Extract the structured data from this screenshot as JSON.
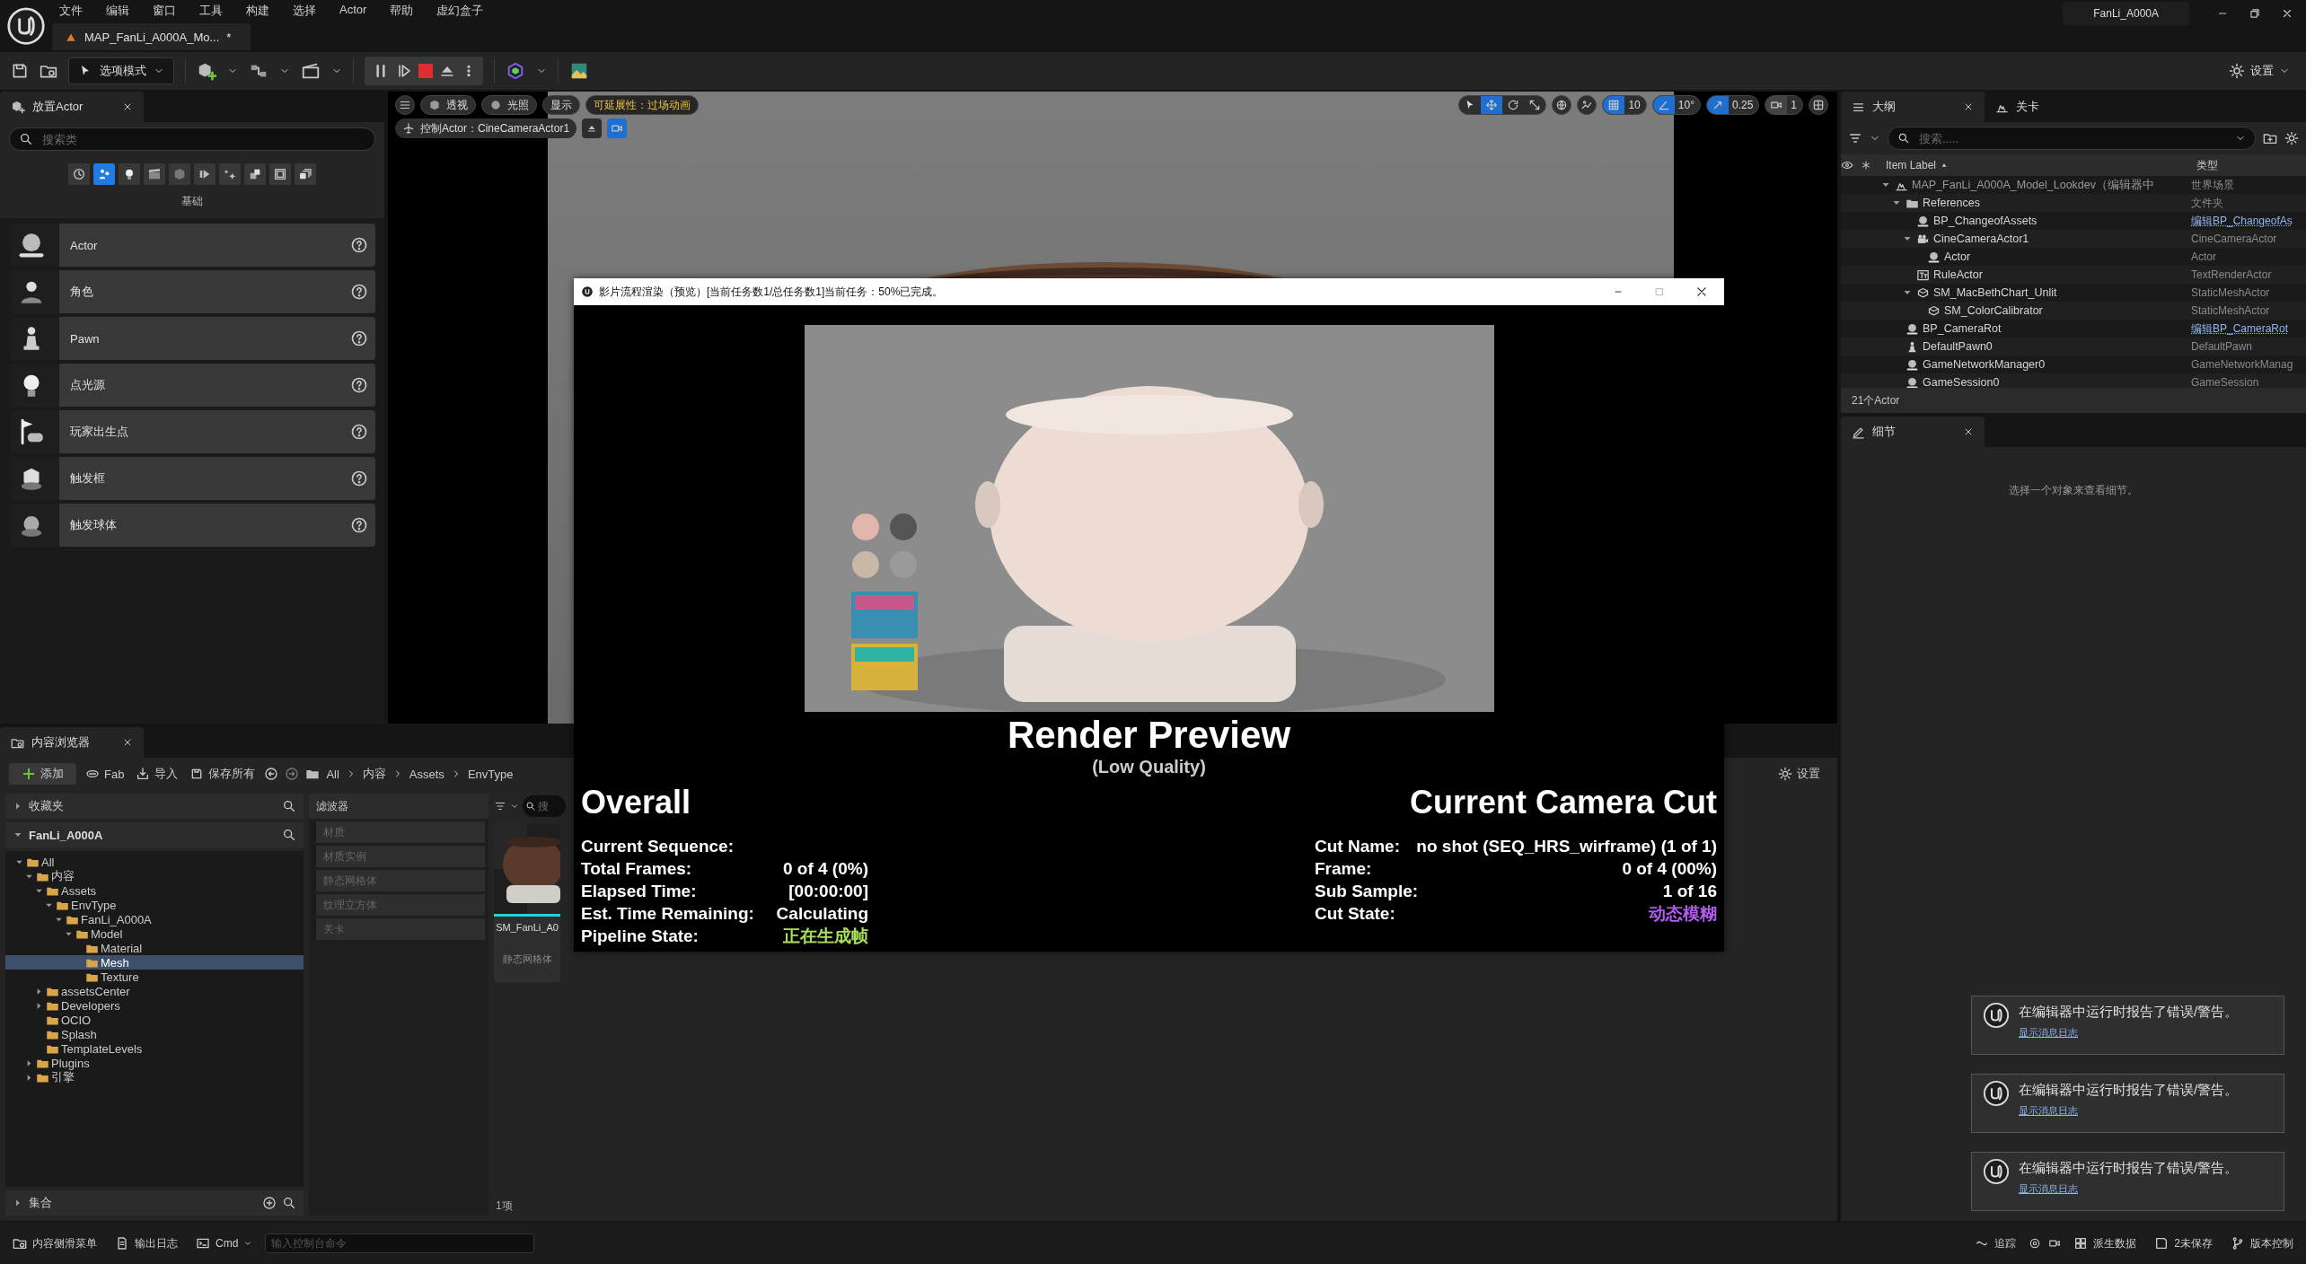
{
  "menu": [
    "文件",
    "编辑",
    "窗口",
    "工具",
    "构建",
    "选择",
    "Actor",
    "帮助",
    "虚幻盒子"
  ],
  "document_tab": {
    "label": "MAP_FanLi_A000A_Mo...",
    "unsaved_mark": "*"
  },
  "project_badge": "FanLi_A000A",
  "toolbar": {
    "mode_button": "选项模式",
    "settings_button": "设置"
  },
  "place_actors": {
    "tab": "放置Actor",
    "search": {
      "placeholder": "搜索类"
    },
    "category_tabs": [
      {
        "selected": false
      },
      {
        "selected": true
      },
      {
        "selected": false
      },
      {
        "selected": false
      },
      {
        "selected": false
      },
      {
        "selected": false
      },
      {
        "selected": false
      },
      {
        "selected": false
      },
      {
        "selected": false
      },
      {
        "selected": false
      }
    ],
    "category_label": "基础",
    "items": [
      {
        "label": "Actor"
      },
      {
        "label": "角色"
      },
      {
        "label": "Pawn"
      },
      {
        "label": "点光源"
      },
      {
        "label": "玩家出生点"
      },
      {
        "label": "触发框"
      },
      {
        "label": "触发球体"
      }
    ]
  },
  "viewport": {
    "view_buttons": [
      "透视",
      "光照",
      "显示"
    ],
    "scalability_chip": "可延展性：过场动画",
    "pilot_label": "控制Actor：CineCameraActor1",
    "transform_tools": [
      {
        "selected": false
      },
      {
        "selected": true
      },
      {
        "selected": false
      },
      {
        "selected": false
      }
    ],
    "snaps": [
      {
        "value": "10",
        "on": true
      },
      {
        "value": "10°",
        "on": true
      },
      {
        "value": "0.25",
        "on": true
      }
    ],
    "camera_speed": "1"
  },
  "outliner": {
    "tabs": [
      {
        "label": "大纲",
        "selected": true
      },
      {
        "label": "关卡",
        "selected": false
      }
    ],
    "search": {
      "placeholder": "搜索....."
    },
    "columns": [
      "Item Label",
      "类型"
    ],
    "rows": [
      {
        "label": "MAP_FanLi_A000A_Model_Lookdev（编辑器中",
        "type": "世界场景",
        "type_is_link": false,
        "expanded": true,
        "children": [
          {
            "label": "References",
            "type": "文件夹",
            "type_is_link": false,
            "expanded": true,
            "children": [
              {
                "label": "BP_ChangeofAssets",
                "type": "编辑BP_ChangeofAs",
                "type_is_link": true
              },
              {
                "label": "CineCameraActor1",
                "type": "CineCameraActor",
                "type_is_link": false,
                "expanded": true,
                "children": [
                  {
                    "label": "Actor",
                    "type": "Actor",
                    "type_is_link": false
                  }
                ]
              },
              {
                "label": "RuleActor",
                "type": "TextRenderActor",
                "type_is_link": false
              },
              {
                "label": "SM_MacBethChart_Unlit",
                "type": "StaticMeshActor",
                "type_is_link": false,
                "expanded": true,
                "children": [
                  {
                    "label": "SM_ColorCalibrator",
                    "type": "StaticMeshActor",
                    "type_is_link": false
                  }
                ]
              }
            ]
          },
          {
            "label": "BP_CameraRot",
            "type": "编辑BP_CameraRot",
            "type_is_link": true
          },
          {
            "label": "DefaultPawn0",
            "type": "DefaultPawn",
            "type_is_link": false
          },
          {
            "label": "GameNetworkManager0",
            "type": "GameNetworkManag",
            "type_is_link": false
          },
          {
            "label": "GameSession0",
            "type": "GameSession",
            "type_is_link": false
          }
        ]
      }
    ],
    "footer": "21个Actor"
  },
  "details": {
    "tab": "细节",
    "empty_message": "选择一个对象来查看细节。"
  },
  "content_browser": {
    "tab": "内容浏览器",
    "actions": [
      "添加",
      "Fab",
      "导入",
      "保存所有"
    ],
    "breadcrumbs": [
      "All",
      "内容",
      "Assets",
      "EnvType"
    ],
    "settings_button": "设置",
    "favorites": {
      "label": "收藏夹",
      "expanded": false
    },
    "root": {
      "label": "FanLi_A000A",
      "expanded": true
    },
    "folders": [
      {
        "label": "All",
        "expanded": true,
        "selected": false,
        "children": [
          {
            "label": "内容",
            "expanded": true,
            "selected": false,
            "children": [
              {
                "label": "Assets",
                "expanded": true,
                "selected": false,
                "children": [
                  {
                    "label": "EnvType",
                    "expanded": true,
                    "selected": false,
                    "children": [
                      {
                        "label": "FanLi_A000A",
                        "expanded": true,
                        "selected": false,
                        "children": [
                          {
                            "label": "Model",
                            "expanded": true,
                            "selected": false,
                            "children": [
                              {
                                "label": "Material",
                                "selected": false
                              },
                              {
                                "label": "Mesh",
                                "selected": true
                              },
                              {
                                "label": "Texture",
                                "selected": false
                              }
                            ]
                          }
                        ]
                      }
                    ]
                  }
                ]
              },
              {
                "label": "assetsCenter",
                "expanded": false,
                "selected": false
              },
              {
                "label": "Developers",
                "expanded": false,
                "selected": false
              },
              {
                "label": "OCIO",
                "selected": false
              },
              {
                "label": "Splash",
                "selected": false
              },
              {
                "label": "TemplateLevels",
                "selected": false
              }
            ]
          },
          {
            "label": "Plugins",
            "expanded": false,
            "selected": false
          },
          {
            "label": "引擎",
            "expanded": false,
            "selected": false
          }
        ]
      }
    ],
    "collections": {
      "label": "集合",
      "expanded": false
    },
    "filters_title": "滤波器",
    "filters": [
      "材质",
      "材质实例",
      "静态网格体",
      "纹理立方体",
      "关卡"
    ],
    "asset_search": {
      "placeholder": "搜"
    },
    "assets": [
      {
        "name": "SM_FanLi_A0",
        "type": "静态网格体"
      }
    ],
    "item_count": "1项"
  },
  "status_bar": {
    "left": [
      "内容侧滑菜单",
      "输出日志"
    ],
    "cmd": "Cmd",
    "console": {
      "placeholder": "输入控制台命令"
    },
    "right": [
      "追踪",
      "派生数据",
      "2未保存",
      "版本控制"
    ]
  },
  "render_dialog": {
    "title": "影片流程渲染（预览）[当前任务数1/总任务数1]当前任务：50%已完成。",
    "heading": "Render Preview",
    "subheading": "(Low Quality)",
    "overall": {
      "title": "Overall",
      "rows": [
        {
          "label": "Current Sequence:"
        },
        {
          "label": "Total Frames:",
          "value": "0 of 4 (0%)"
        },
        {
          "label": "Elapsed Time:",
          "value": "[00:00:00]"
        },
        {
          "label": "Est. Time Remaining:",
          "value": "Calculating"
        },
        {
          "label": "Pipeline State:",
          "value": "正在生成帧",
          "color": "#a8e05a"
        }
      ]
    },
    "camera_cut": {
      "title": "Current Camera Cut",
      "rows": [
        {
          "label": "Cut Name:",
          "value": "no shot (SEQ_HRS_wirframe) (1 of 1)"
        },
        {
          "label": "Frame:",
          "value": "0 of 4 (00%)"
        },
        {
          "label": "Sub Sample:",
          "value": "1 of 16"
        },
        {
          "label": "Cut State:",
          "value": "动态模糊",
          "color": "#b45cf2"
        }
      ]
    }
  },
  "notifications": [
    {
      "message": "在编辑器中运行时报告了错误/警告。",
      "link": "显示消息日志"
    },
    {
      "message": "在编辑器中运行时报告了错误/警告。",
      "link": "显示消息日志"
    },
    {
      "message": "在编辑器中运行时报告了错误/警告。",
      "link": "显示消息日志"
    }
  ]
}
